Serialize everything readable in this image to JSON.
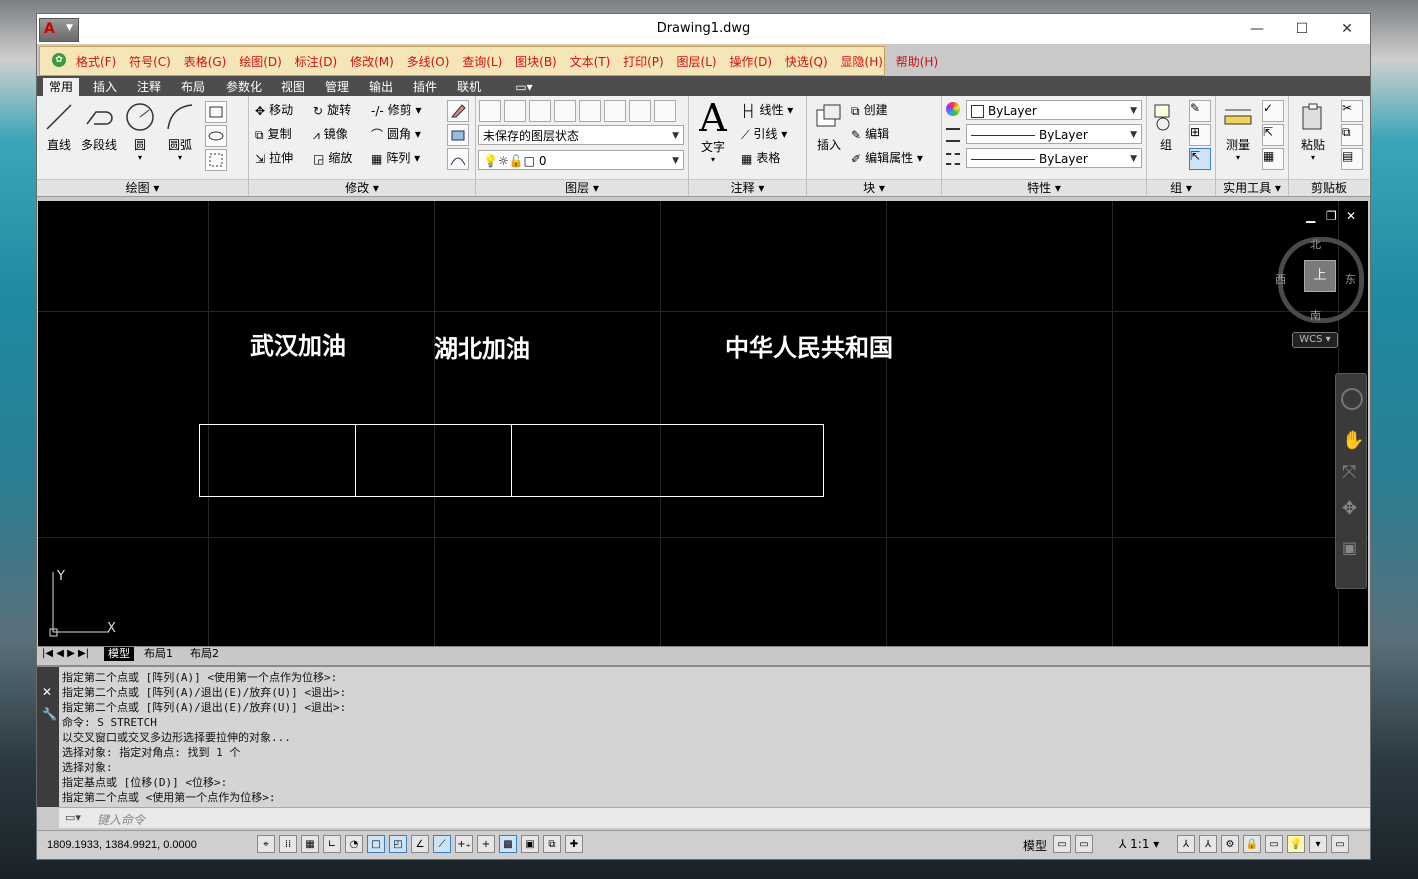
{
  "window": {
    "title": "Drawing1.dwg",
    "minimize": "—",
    "maximize": "☐",
    "close": "✕"
  },
  "menubar": {
    "items": [
      "格式(F)",
      "符号(C)",
      "表格(G)",
      "绘图(D)",
      "标注(D)",
      "修改(M)",
      "多线(O)",
      "查询(L)",
      "图块(B)",
      "文本(T)",
      "打印(P)",
      "图层(L)",
      "操作(D)",
      "快选(Q)",
      "显隐(H)",
      "帮助(H)"
    ]
  },
  "ribbon_tabs": [
    "常用",
    "插入",
    "注释",
    "布局",
    "参数化",
    "视图",
    "管理",
    "输出",
    "插件",
    "联机"
  ],
  "panels": {
    "draw": {
      "title": "绘图 ▾",
      "line": "直线",
      "polyline": "多段线",
      "circle": "圆",
      "arc": "圆弧"
    },
    "modify": {
      "title": "修改 ▾",
      "move": "移动",
      "rotate": "旋转",
      "trim": "修剪",
      "copy": "复制",
      "mirror": "镜像",
      "fillet": "圆角",
      "stretch": "拉伸",
      "scale": "缩放",
      "array": "阵列"
    },
    "layers": {
      "title": "图层 ▾",
      "state": "未保存的图层状态",
      "current": "0"
    },
    "annotation": {
      "title": "注释 ▾",
      "text": "文字",
      "dim": "线性",
      "leader": "引线",
      "table": "表格"
    },
    "block": {
      "title": "块 ▾",
      "insert": "插入",
      "create": "创建",
      "edit": "编辑",
      "edit_attr": "编辑属性"
    },
    "properties": {
      "title": "特性 ▾",
      "color": "ByLayer",
      "linetype": "ByLayer",
      "lineweight": "ByLayer"
    },
    "groups": {
      "title": "组 ▾",
      "group": "组"
    },
    "utilities": {
      "title": "实用工具 ▾",
      "measure": "测量"
    },
    "clipboard": {
      "title": "剪贴板",
      "paste": "粘贴"
    }
  },
  "canvas": {
    "texts": [
      "武汉加油",
      "湖北加油",
      "中华人民共和国"
    ],
    "compass": {
      "n": "北",
      "s": "南",
      "e": "东",
      "w": "西",
      "center": "上"
    },
    "wcs": "WCS",
    "ucs": {
      "y": "Y",
      "x": "X"
    }
  },
  "layout_tabs": [
    "模型",
    "布局1",
    "布局2"
  ],
  "command_history": [
    "指定第二个点或 [阵列(A)] <使用第一个点作为位移>:",
    "指定第二个点或 [阵列(A)/退出(E)/放弃(U)] <退出>:",
    "指定第二个点或 [阵列(A)/退出(E)/放弃(U)] <退出>:",
    "命令: S STRETCH",
    "以交叉窗口或交叉多边形选择要拉伸的对象...",
    "选择对象: 指定对角点: 找到 1 个",
    "选择对象:",
    "指定基点或 [位移(D)] <位移>:",
    "指定第二个点或 <使用第一个点作为位移>:"
  ],
  "command_input": {
    "placeholder": "键入命令"
  },
  "status": {
    "coords": "1809.1933,  1384.9921,  0.0000",
    "model": "模型",
    "scale": "1:1"
  }
}
